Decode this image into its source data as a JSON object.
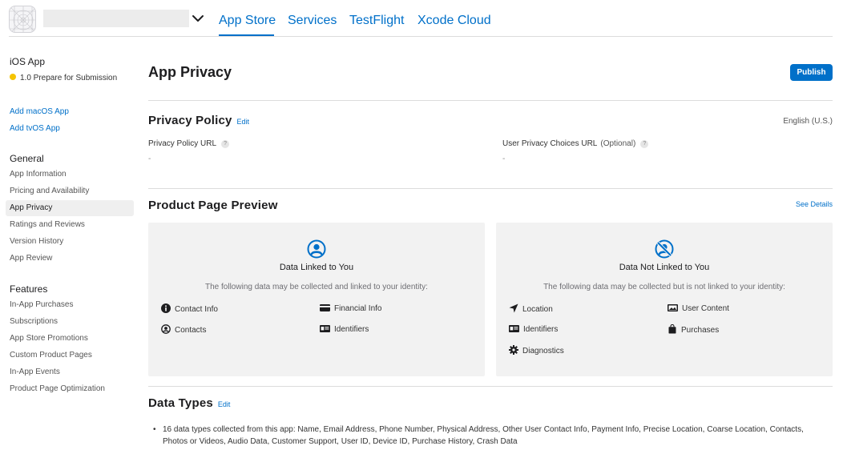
{
  "header": {
    "tabs": [
      {
        "label": "App Store",
        "active": true
      },
      {
        "label": "Services",
        "active": false
      },
      {
        "label": "TestFlight",
        "active": false
      },
      {
        "label": "Xcode Cloud",
        "active": false
      }
    ]
  },
  "sidebar": {
    "app_title": "iOS App",
    "version_status": "1.0 Prepare for Submission",
    "status_color": "#f5c400",
    "add_links": [
      "Add macOS App",
      "Add tvOS App"
    ],
    "general_heading": "General",
    "general_items": [
      {
        "label": "App Information"
      },
      {
        "label": "Pricing and Availability"
      },
      {
        "label": "App Privacy",
        "selected": true
      },
      {
        "label": "Ratings and Reviews"
      },
      {
        "label": "Version History"
      },
      {
        "label": "App Review"
      }
    ],
    "features_heading": "Features",
    "features_items": [
      {
        "label": "In-App Purchases"
      },
      {
        "label": "Subscriptions"
      },
      {
        "label": "App Store Promotions"
      },
      {
        "label": "Custom Product Pages"
      },
      {
        "label": "In-App Events"
      },
      {
        "label": "Product Page Optimization"
      }
    ]
  },
  "main": {
    "title": "App Privacy",
    "publish_label": "Publish",
    "privacy_policy": {
      "title": "Privacy Policy",
      "edit_label": "Edit",
      "language": "English (U.S.)",
      "policy_url_label": "Privacy Policy URL",
      "policy_url_value": "-",
      "choices_url_label": "User Privacy Choices URL",
      "choices_url_optional": "(Optional)",
      "choices_url_value": "-",
      "help_glyph": "?"
    },
    "product_page_preview": {
      "title": "Product Page Preview",
      "see_details_label": "See Details",
      "linked": {
        "icon": "person-circle-icon",
        "title": "Data Linked to You",
        "description": "The following data may be collected and linked to your identity:",
        "categories": [
          {
            "label": "Contact Info",
            "icon": "info-icon"
          },
          {
            "label": "Financial Info",
            "icon": "credit-card-icon"
          },
          {
            "label": "Contacts",
            "icon": "person-circle-icon"
          },
          {
            "label": "Identifiers",
            "icon": "id-card-icon"
          }
        ]
      },
      "not_linked": {
        "icon": "person-slash-icon",
        "title": "Data Not Linked to You",
        "description": "The following data may be collected but is not linked to your identity:",
        "categories": [
          {
            "label": "Location",
            "icon": "location-arrow-icon"
          },
          {
            "label": "User Content",
            "icon": "photo-icon"
          },
          {
            "label": "Identifiers",
            "icon": "id-card-icon"
          },
          {
            "label": "Purchases",
            "icon": "shopping-bag-icon"
          },
          {
            "label": "Diagnostics",
            "icon": "gear-icon"
          }
        ]
      }
    },
    "data_types": {
      "title": "Data Types",
      "edit_label": "Edit",
      "summary": "16 data types collected from this app: Name, Email Address, Phone Number, Physical Address, Other User Contact Info, Payment Info, Precise Location, Coarse Location, Contacts, Photos or Videos, Audio Data, Customer Support, User ID, Device ID, Purchase History, Crash Data"
    }
  },
  "colors": {
    "accent": "#0070c9",
    "card_bg": "#f2f2f2",
    "status_dot": "#f5c400"
  }
}
